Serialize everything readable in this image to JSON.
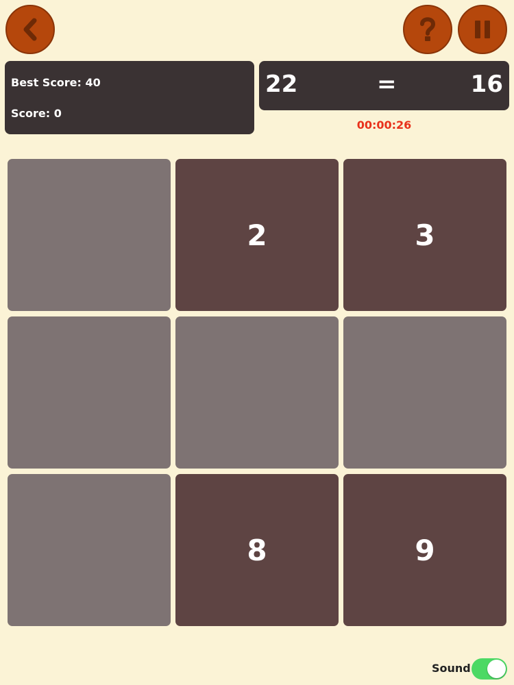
{
  "header": {
    "back_icon": "chevron-left-icon",
    "help_icon": "question-mark-icon",
    "pause_icon": "pause-icon"
  },
  "scores": {
    "best": "Best Score: 40",
    "current": "Score: 0"
  },
  "equation": {
    "left": "22",
    "operator": "=",
    "target": "16"
  },
  "timer": "00:00:26",
  "grid": {
    "tiles": [
      {
        "value": "",
        "state": "empty"
      },
      {
        "value": "2",
        "state": "filled"
      },
      {
        "value": "3",
        "state": "filled"
      },
      {
        "value": "",
        "state": "empty"
      },
      {
        "value": "",
        "state": "empty"
      },
      {
        "value": "",
        "state": "empty"
      },
      {
        "value": "",
        "state": "empty"
      },
      {
        "value": "8",
        "state": "filled"
      },
      {
        "value": "9",
        "state": "filled"
      }
    ]
  },
  "footer": {
    "sound_label": "Sound",
    "sound_on": true
  },
  "colors": {
    "background": "#FBF3D6",
    "button": "#B5470C",
    "panel": "#3A3233",
    "tile_empty": "#7E7373",
    "tile_filled": "#5E4443",
    "timer": "#E8311B",
    "toggle_on": "#4CD964"
  }
}
